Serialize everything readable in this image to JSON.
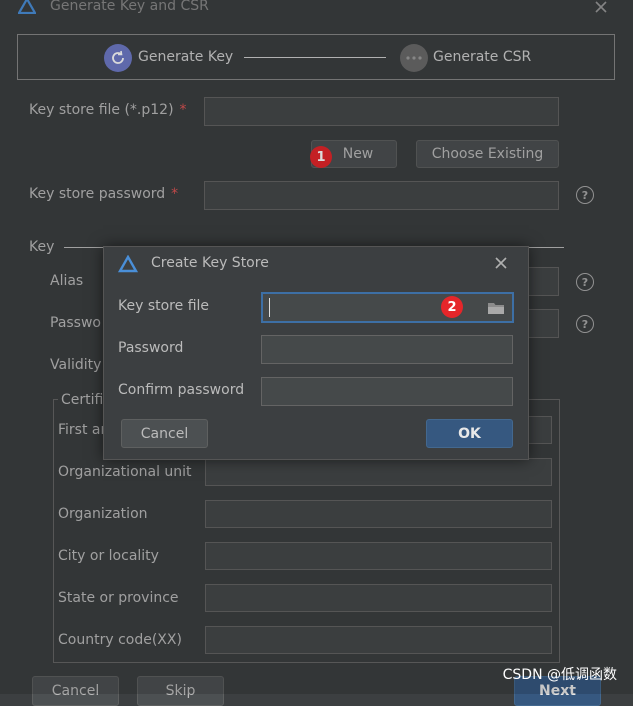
{
  "window": {
    "title": "Generate Key and CSR"
  },
  "steps": [
    {
      "label": "Generate Key"
    },
    {
      "label": "Generate CSR"
    }
  ],
  "form": {
    "key_store_file_label": "Key store file (*.p12)",
    "required_marker": "*",
    "new_button": "New",
    "choose_existing_button": "Choose Existing",
    "key_store_password_label": "Key store password",
    "key_section_label": "Key",
    "alias_label": "Alias",
    "password_label": "Passwo",
    "validity_label": "Validity",
    "certificate_label": "Certifi",
    "first_and_last_name_label": "First ar",
    "organizational_unit_label": "Organizational unit",
    "organization_label": "Organization",
    "city_label": "City or locality",
    "state_label": "State or province",
    "country_code_label": "Country code(XX)",
    "help_glyph": "?"
  },
  "footer": {
    "cancel_button": "Cancel",
    "skip_button": "Skip",
    "next_button": "Next"
  },
  "dialog": {
    "title": "Create Key Store",
    "key_store_file_label": "Key store file",
    "key_store_file_value": "",
    "password_label": "Password",
    "confirm_password_label": "Confirm password",
    "cancel_button": "Cancel",
    "ok_button": "OK"
  },
  "annotations": {
    "badge_1": "1",
    "badge_2": "2"
  },
  "watermark": "CSDN @低调函数",
  "colors": {
    "background": "#3c3f41",
    "field": "#45494a",
    "accent_primary_button": "#365880",
    "step_active": "#6f7bc8",
    "step_inactive": "#6a6a6a",
    "required": "#e05555",
    "badge": "#e5262a"
  },
  "icons": {
    "app_logo": "triangle-logo-icon",
    "close": "close-icon",
    "step_active": "refresh-circle-icon",
    "step_inactive": "ellipsis-circle-icon",
    "help": "question-circle-icon",
    "folder": "folder-icon"
  }
}
